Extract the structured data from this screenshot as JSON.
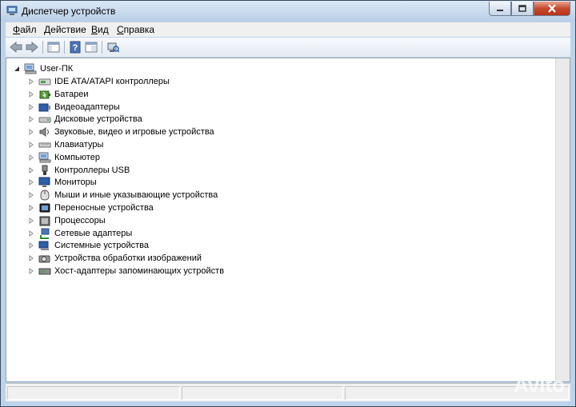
{
  "window": {
    "title": "Диспетчер устройств"
  },
  "menu": [
    {
      "label": "Файл"
    },
    {
      "label": "Действие"
    },
    {
      "label": "Вид"
    },
    {
      "label": "Справка"
    }
  ],
  "tree": {
    "root": "User-ПК",
    "items": [
      {
        "label": "IDE ATA/ATAPI контроллеры",
        "icon": "ide-controller-icon"
      },
      {
        "label": "Батареи",
        "icon": "battery-icon"
      },
      {
        "label": "Видеоадаптеры",
        "icon": "display-adapter-icon"
      },
      {
        "label": "Дисковые устройства",
        "icon": "disk-drive-icon"
      },
      {
        "label": "Звуковые, видео и игровые устройства",
        "icon": "speaker-icon"
      },
      {
        "label": "Клавиатуры",
        "icon": "keyboard-icon"
      },
      {
        "label": "Компьютер",
        "icon": "computer-icon"
      },
      {
        "label": "Контроллеры USB",
        "icon": "usb-icon"
      },
      {
        "label": "Мониторы",
        "icon": "monitor-icon"
      },
      {
        "label": "Мыши и иные указывающие устройства",
        "icon": "mouse-icon"
      },
      {
        "label": "Переносные устройства",
        "icon": "portable-device-icon"
      },
      {
        "label": "Процессоры",
        "icon": "processor-icon"
      },
      {
        "label": "Сетевые адаптеры",
        "icon": "network-adapter-icon"
      },
      {
        "label": "Системные устройства",
        "icon": "system-device-icon"
      },
      {
        "label": "Устройства обработки изображений",
        "icon": "imaging-device-icon"
      },
      {
        "label": "Хост-адаптеры запоминающих устройств",
        "icon": "storage-controller-icon"
      }
    ]
  },
  "watermark": "Avito"
}
